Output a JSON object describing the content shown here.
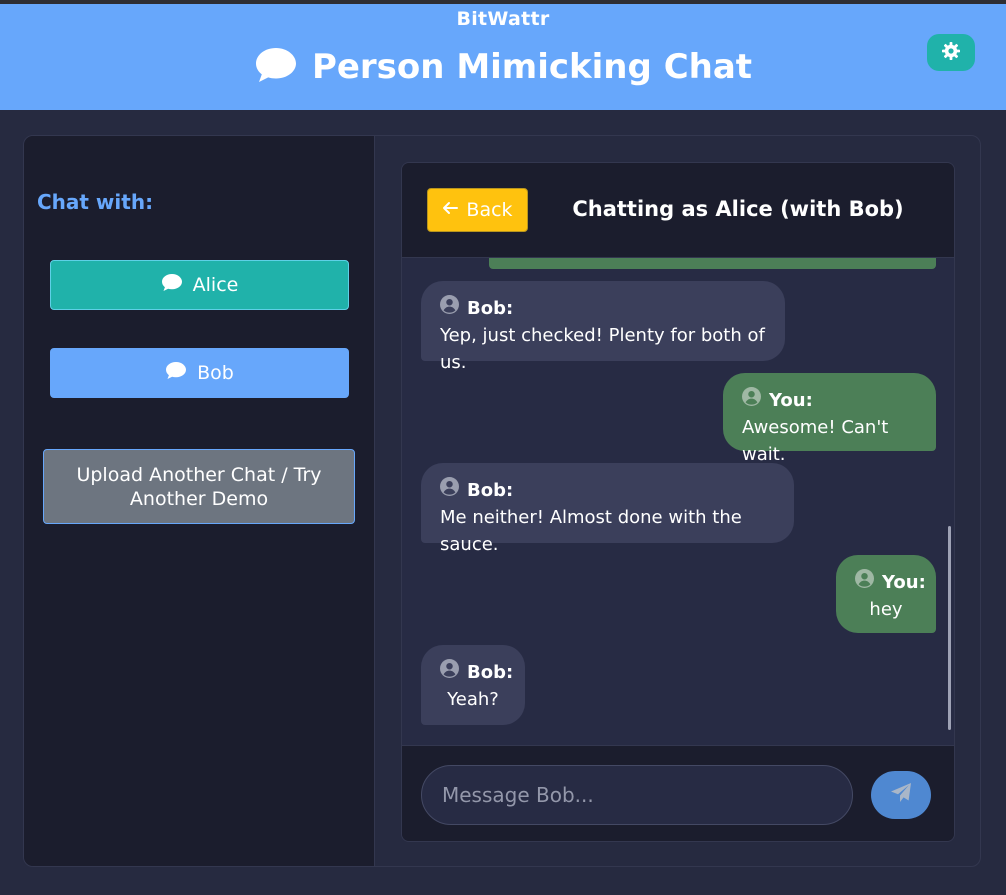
{
  "header": {
    "brand": "BitWattr",
    "title": "Person Mimicking Chat",
    "title_icon": "chat-bubble-icon",
    "theme_icon": "gear-icon"
  },
  "sidebar": {
    "heading": "Chat with:",
    "contacts": [
      {
        "label": "Alice",
        "icon": "chat-bubble-icon",
        "color": "#20b2aa",
        "active": true
      },
      {
        "label": "Bob",
        "icon": "chat-bubble-icon",
        "color": "#67a7fb",
        "active": false
      }
    ],
    "upload_label": "Upload Another Chat / Try Another Demo"
  },
  "chat": {
    "back_label": "Back",
    "title": "Chatting as Alice (with Bob)",
    "messages": [
      {
        "sender": "Bob:",
        "text": "Yep, just checked! Plenty for both of us.",
        "from_me": false
      },
      {
        "sender": "You:",
        "text": "Awesome! Can't wait.",
        "from_me": true
      },
      {
        "sender": "Bob:",
        "text": "Me neither! Almost done with the sauce.",
        "from_me": false
      },
      {
        "sender": "You:",
        "text": "hey",
        "from_me": true
      },
      {
        "sender": "Bob:",
        "text": "Yeah?",
        "from_me": false
      }
    ],
    "input_placeholder": "Message Bob...",
    "send_icon": "paper-plane-icon"
  },
  "colors": {
    "header_bg": "#67a7fb",
    "accent_teal": "#20b2aa",
    "back_button": "#ffc20e",
    "my_bubble": "#4c7f57",
    "bot_bubble": "#3b3f5b"
  }
}
